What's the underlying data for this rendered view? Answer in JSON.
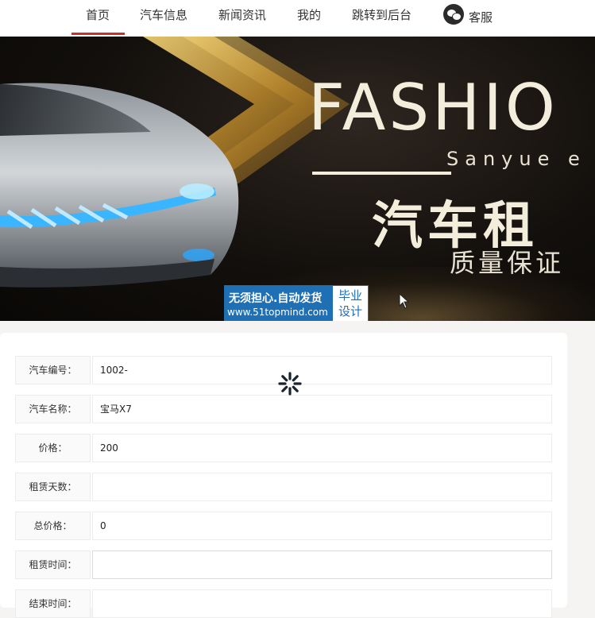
{
  "nav": {
    "items": [
      "首页",
      "汽车信息",
      "新闻资讯",
      "我的",
      "跳转到后台"
    ],
    "service_label": "客服",
    "active_color": "#c9302c"
  },
  "banner": {
    "title": "FASHIO",
    "subtitle": "Sanyue e",
    "cn_title": "汽车租",
    "cn_subtitle": "质量保证",
    "watermark_line1": "无须担心.自动发货",
    "watermark_line2": "www.51topmind.com",
    "watermark_box": "毕业设计"
  },
  "form": {
    "rows": [
      {
        "label": "汽车编号：",
        "value": "1002-"
      },
      {
        "label": "汽车名称：",
        "value": "宝马X7"
      },
      {
        "label": "价格：",
        "value": "200"
      },
      {
        "label": "租赁天数：",
        "value": ""
      },
      {
        "label": "总价格：",
        "value": "0"
      },
      {
        "label": "租赁时间：",
        "value": ""
      },
      {
        "label": "结束时间：",
        "value": ""
      }
    ]
  }
}
